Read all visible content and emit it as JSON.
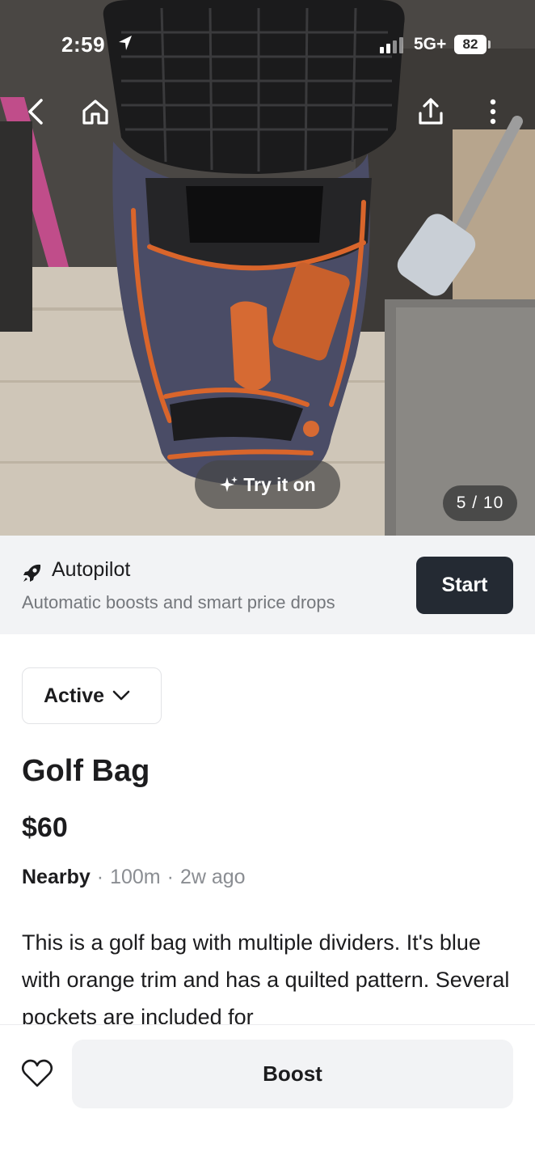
{
  "status_bar": {
    "time": "2:59",
    "network": "5G+",
    "battery": "82"
  },
  "photo": {
    "alt": "Golf Bag",
    "try_on_label": "Try it on",
    "counter": "5 / 10"
  },
  "autopilot": {
    "title": "Autopilot",
    "subtitle": "Automatic boosts and smart price drops",
    "start_label": "Start"
  },
  "listing": {
    "status": "Active",
    "title": "Golf Bag",
    "price": "$60",
    "location": "Nearby",
    "distance": "100m",
    "posted": "2w ago",
    "description": "This is a golf bag with multiple dividers. It's blue with orange trim and has a quilted pattern. Several pockets are included for"
  },
  "bottom": {
    "boost_label": "Boost"
  },
  "colors": {
    "primary_dark": "#242a33",
    "banner_bg": "#f2f3f5",
    "muted_text": "#74777c"
  }
}
